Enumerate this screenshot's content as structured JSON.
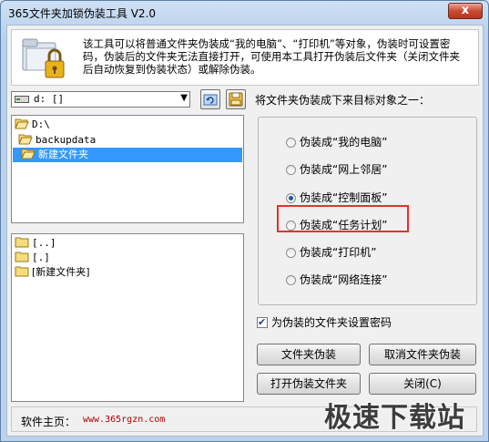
{
  "window": {
    "title": "365文件夹加锁伪装工具 V2.0",
    "close_label": "x"
  },
  "description": "该工具可以将普通文件夹伪装成“我的电脑”、“打印机”等对象，伪装时可设置密码，伪装后的文件夹无法直接打开，可使用本工具打开伪装后文件夹（关闭文件夹后自动恢复到伪装状态）或解除伪装。",
  "drive": {
    "value": "d: []"
  },
  "target_label": "将文件夹伪装成下来目标对象之一：",
  "tree": [
    {
      "label": "D:\\",
      "selected": false
    },
    {
      "label": "backupdata",
      "selected": false
    },
    {
      "label": "新建文件夹",
      "selected": true
    }
  ],
  "files": [
    {
      "label": "[..]"
    },
    {
      "label": "[.]"
    },
    {
      "label": "[新建文件夹]"
    }
  ],
  "options": [
    {
      "label": "伪装成“我的电脑”",
      "checked": false
    },
    {
      "label": "伪装成“网上邻居”",
      "checked": false
    },
    {
      "label": "伪装成“控制面板”",
      "checked": true
    },
    {
      "label": "伪装成“任务计划”",
      "checked": false
    },
    {
      "label": "伪装成“打印机”",
      "checked": false
    },
    {
      "label": "伪装成“网络连接”",
      "checked": false
    }
  ],
  "password_checkbox": {
    "label": "为伪装的文件夹设置密码",
    "checked": true
  },
  "buttons": {
    "disguise": "文件夹伪装",
    "undisguise": "取消文件夹伪装",
    "open": "打开伪装文件夹",
    "close": "关闭(C)"
  },
  "footer": {
    "label": "软件主页：",
    "url": "www.365rgzn.com"
  },
  "watermark": "极速下载站",
  "colors": {
    "selection": "#3399ff",
    "highlight_box": "#e5312c",
    "url": "#b00000"
  }
}
